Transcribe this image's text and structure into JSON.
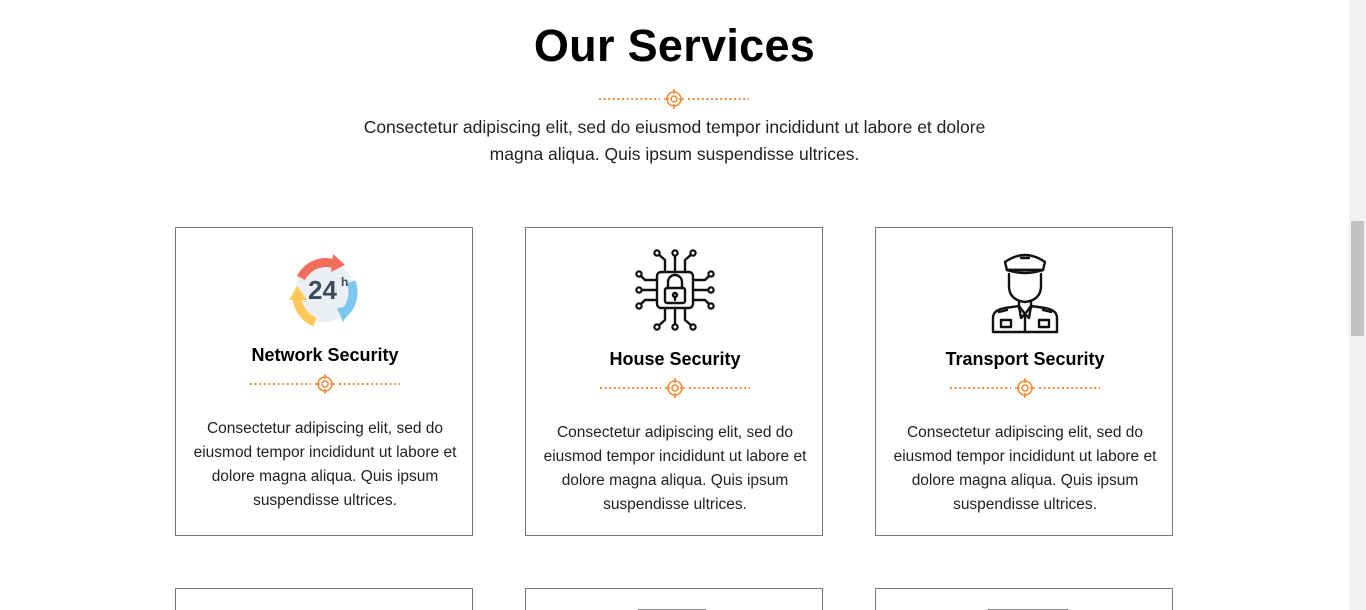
{
  "section": {
    "title": "Our Services",
    "subtitle": "Consectetur adipiscing elit, sed do eiusmod tempor incididunt ut labore et dolore magna aliqua. Quis ipsum suspendisse ultrices."
  },
  "services": [
    {
      "title": "Network Security",
      "icon": "24h-support-icon",
      "description": "Consectetur adipiscing elit, sed do eiusmod tempor incididunt ut labore et dolore magna aliqua. Quis ipsum suspendisse ultrices.",
      "icon_text": "24",
      "icon_sup": "h"
    },
    {
      "title": "House Security",
      "icon": "circuit-lock-icon",
      "description": "Consectetur adipiscing elit, sed do eiusmod tempor incididunt ut labore et dolore magna aliqua. Quis ipsum suspendisse ultrices."
    },
    {
      "title": "Transport Security",
      "icon": "security-guard-icon",
      "description": "Consectetur adipiscing elit, sed do eiusmod tempor incididunt ut labore et dolore magna aliqua. Quis ipsum suspendisse ultrices."
    }
  ],
  "colors": {
    "accent": "#f28c38",
    "text": "#222222",
    "border": "#777777"
  }
}
